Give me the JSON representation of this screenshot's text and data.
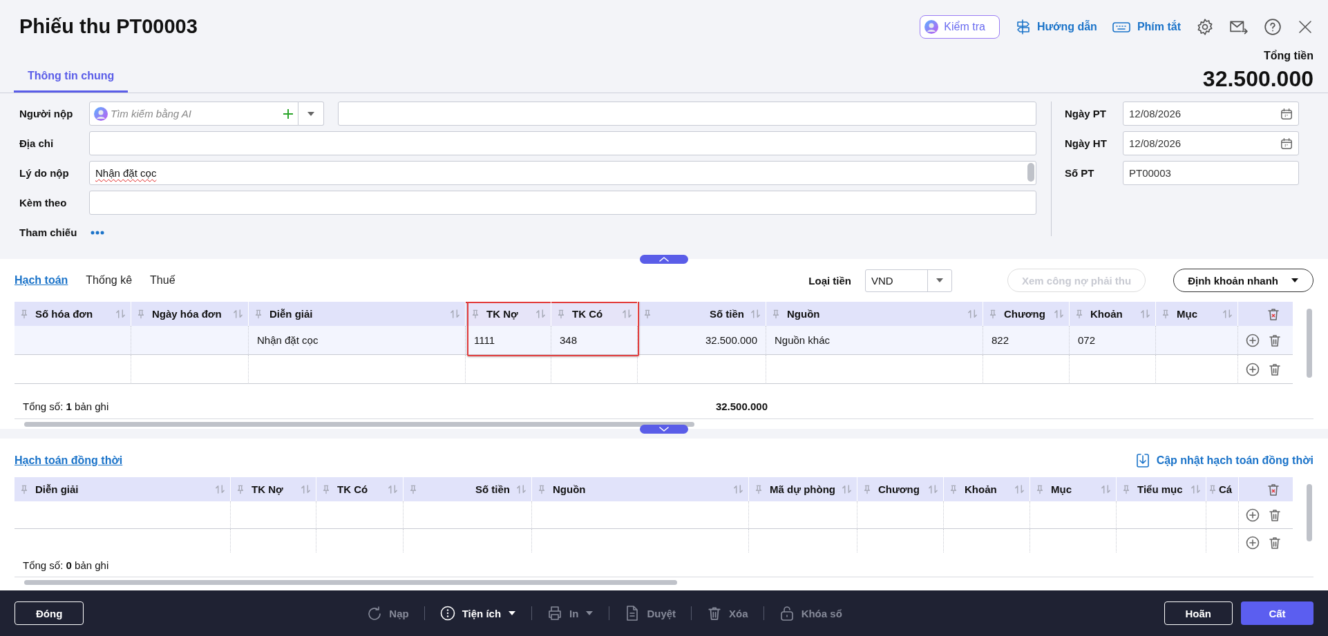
{
  "window": {
    "title": "Phiếu thu PT00003"
  },
  "header_actions": [
    {
      "kind": "check",
      "label": "Kiểm tra"
    },
    {
      "kind": "guide",
      "label": "Hướng dẫn"
    },
    {
      "kind": "shortcuts",
      "label": "Phím tắt"
    },
    {
      "kind": "settings"
    },
    {
      "kind": "mail"
    },
    {
      "kind": "help"
    },
    {
      "kind": "close"
    }
  ],
  "total": {
    "label": "Tổng tiền",
    "value": "32.500.000"
  },
  "tabs": [
    {
      "label": "Thông tin chung",
      "selected": true
    }
  ],
  "form": {
    "fields": [
      {
        "kind": "payer",
        "label": "Người nộp",
        "placeholder": "Tìm kiếm bằng AI"
      },
      {
        "kind": "text",
        "label": "Địa chỉ"
      },
      {
        "kind": "textarea",
        "label": "Lý do nộp",
        "value": "Nhận đặt cọc"
      },
      {
        "kind": "text",
        "label": "Kèm theo"
      },
      {
        "kind": "more",
        "label": "Tham chiếu"
      }
    ],
    "side_fields": [
      {
        "kind": "date",
        "label": "Ngày PT",
        "value": "12/08/2026"
      },
      {
        "kind": "date",
        "label": "Ngày HT",
        "value": "12/08/2026"
      },
      {
        "kind": "text",
        "label": "Số PT",
        "value": "PT00003"
      }
    ]
  },
  "detail": {
    "tabs": [
      {
        "label": "Hạch toán",
        "selected": true
      },
      {
        "label": "Thống kê",
        "selected": false
      },
      {
        "label": "Thuế",
        "selected": false
      }
    ],
    "currency": {
      "label": "Loại tiền",
      "value": "VND"
    },
    "buttons": [
      {
        "kind": "plain",
        "label": "Xem công nợ phải thu",
        "disabled": true
      },
      {
        "kind": "dropdown",
        "label": "Định khoản nhanh",
        "disabled": false
      }
    ],
    "table": {
      "columns": [
        {
          "label": "Số hóa đơn",
          "highlighted": false
        },
        {
          "label": "Ngày hóa đơn",
          "highlighted": false
        },
        {
          "label": "Diễn giải",
          "highlighted": false
        },
        {
          "label": "TK Nợ",
          "highlighted": true
        },
        {
          "label": "TK Có",
          "highlighted": true
        },
        {
          "label": "Số tiền",
          "highlighted": false
        },
        {
          "label": "Nguồn",
          "highlighted": false
        },
        {
          "label": "Chương",
          "highlighted": false
        },
        {
          "label": "Khoản",
          "highlighted": false
        },
        {
          "label": "Mục",
          "highlighted": false
        }
      ],
      "rows": [
        {
          "cells": [
            null,
            null,
            "Nhận đặt cọc",
            "1111",
            "348",
            "32.500.000",
            "Nguồn khác",
            "822",
            "072",
            null
          ]
        },
        {
          "cells": [
            null,
            null,
            null,
            null,
            null,
            null,
            null,
            null,
            null,
            null
          ]
        }
      ],
      "summary": "Tổng số: **1** bản ghi",
      "sum": "32.500.000"
    }
  },
  "simultaneous": {
    "title": "Hạch toán đồng thời",
    "update_link": "Cập nhật hạch toán đồng thời",
    "table": {
      "columns": [
        {
          "label": "Diễn giải"
        },
        {
          "label": "TK Nợ"
        },
        {
          "label": "TK Có"
        },
        {
          "label": "Số tiền"
        },
        {
          "label": "Nguồn"
        },
        {
          "label": "Mã dự phòng"
        },
        {
          "label": "Chương"
        },
        {
          "label": "Khoản"
        },
        {
          "label": "Mục"
        },
        {
          "label": "Tiểu mục"
        },
        {
          "label": "Cá"
        }
      ],
      "rows": [
        {
          "cells": [
            null,
            null,
            null,
            null,
            null,
            null,
            null,
            null,
            null,
            null,
            null
          ]
        },
        {
          "cells": [
            null,
            null,
            null,
            null,
            null,
            null,
            null,
            null,
            null,
            null,
            null
          ]
        }
      ],
      "summary": "Tổng số: **0** bản ghi"
    }
  },
  "bottom_bar": {
    "close": "Đóng",
    "tools": [
      {
        "kind": "reload",
        "label": "Nạp",
        "disabled": true,
        "dropdown": false
      },
      {
        "kind": "utilities",
        "label": "Tiện ích",
        "disabled": false,
        "dropdown": true
      },
      {
        "kind": "print",
        "label": "In",
        "disabled": true,
        "dropdown": true
      },
      {
        "kind": "approve",
        "label": "Duyệt",
        "disabled": true,
        "dropdown": false
      },
      {
        "kind": "delete",
        "label": "Xóa",
        "disabled": true,
        "dropdown": false
      },
      {
        "kind": "lock",
        "label": "Khóa sổ",
        "disabled": true,
        "dropdown": false
      }
    ],
    "defer": "Hoãn",
    "save": "Cất"
  }
}
